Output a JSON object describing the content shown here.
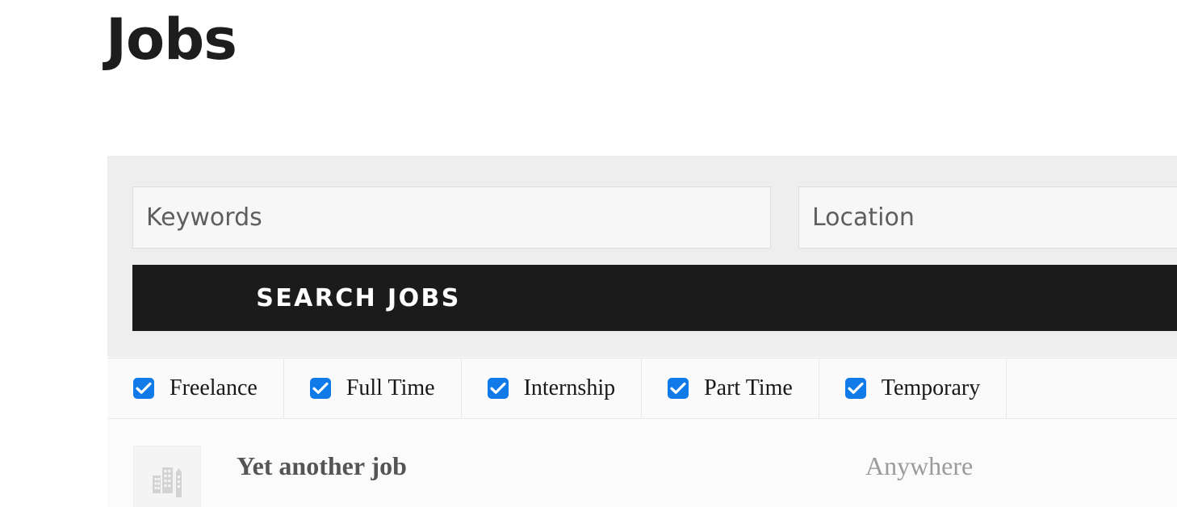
{
  "page": {
    "title": "Jobs"
  },
  "search": {
    "keywords": {
      "placeholder": "Keywords",
      "value": ""
    },
    "location": {
      "placeholder": "Location",
      "value": ""
    },
    "submit_label": "Search Jobs"
  },
  "filters": {
    "items": [
      {
        "label": "Freelance",
        "checked": true
      },
      {
        "label": "Full Time",
        "checked": true
      },
      {
        "label": "Internship",
        "checked": true
      },
      {
        "label": "Part Time",
        "checked": true
      },
      {
        "label": "Temporary",
        "checked": true
      }
    ]
  },
  "jobs": [
    {
      "title": "Yet another job",
      "location": "Anywhere",
      "logo_icon": "buildings-placeholder-icon"
    }
  ],
  "colors": {
    "panel_background": "#eeeeee",
    "filter_background": "#fafafa",
    "button_background": "#1b1b1b",
    "checkbox_accent": "#107ae8",
    "title_color": "#1d1d1d",
    "placeholder_color": "#5e5e5e",
    "job_title_color": "#555555",
    "job_location_color": "#9b9b9b"
  }
}
